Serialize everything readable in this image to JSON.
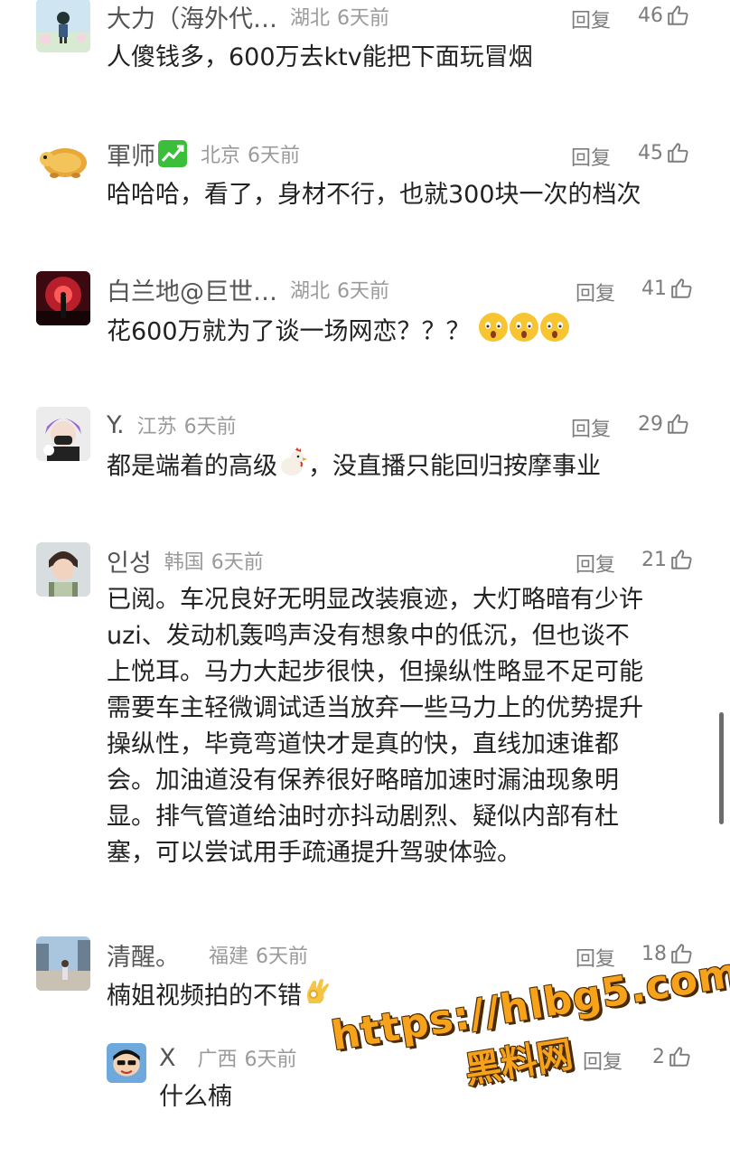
{
  "comments": [
    {
      "user": "大力（海外代…",
      "location": "湖北",
      "time": "6天前",
      "reply": "回复",
      "likes": "46",
      "text": "人傻钱多，600万去ktv能把下面玩冒烟"
    },
    {
      "user": "軍师",
      "location": "北京",
      "time": "6天前",
      "reply": "回复",
      "likes": "45",
      "text": "哈哈哈，看了，身材不行，也就300块一次的档次"
    },
    {
      "user": "白兰地@巨世…",
      "location": "湖北",
      "time": "6天前",
      "reply": "回复",
      "likes": "41",
      "text": "花600万就为了谈一场网恋？？？"
    },
    {
      "user": "Y.",
      "location": "江苏",
      "time": "6天前",
      "reply": "回复",
      "likes": "29",
      "text_a": "都是端着的高级",
      "text_b": "，没直播只能回归按摩事业"
    },
    {
      "user": "인성",
      "location": "韩国",
      "time": "6天前",
      "reply": "回复",
      "likes": "21",
      "lines": [
        "已阅。车况良好无明显改装痕迹，大灯略暗有少许",
        "uzi、发动机轰鸣声没有想象中的低沉，但也谈不",
        "上悦耳。马力大起步很快，但操纵性略显不足可能",
        "需要车主轻微调试适当放弃一些马力上的优势提升",
        "操纵性，毕竟弯道快才是真的快，直线加速谁都",
        "会。加油道没有保养很好略暗加速时漏油现象明",
        "显。排气管道给油时亦抖动剧烈、疑似内部有杜",
        "塞，可以尝试用手疏通提升驾驶体验。"
      ]
    },
    {
      "user": "清醒。",
      "location": "福建",
      "time": "6天前",
      "reply": "回复",
      "likes": "18",
      "text": "楠姐视频拍的不错"
    },
    {
      "user": "X",
      "location": "广西",
      "time": "6天前",
      "reply": "回复",
      "likes": "2",
      "text": "什么楠"
    }
  ],
  "watermark": {
    "line1": "https://hlbg5.com",
    "line2": "黑料网"
  },
  "colors": {
    "username": "#555555",
    "meta": "#9a9a9a",
    "text": "#222222",
    "watermark": "#f7a21b"
  },
  "icons": [
    "thumbs-up-icon",
    "stock-chart-badge-icon",
    "crying-face-emoji",
    "chicken-emoji",
    "ok-hand-emoji"
  ]
}
